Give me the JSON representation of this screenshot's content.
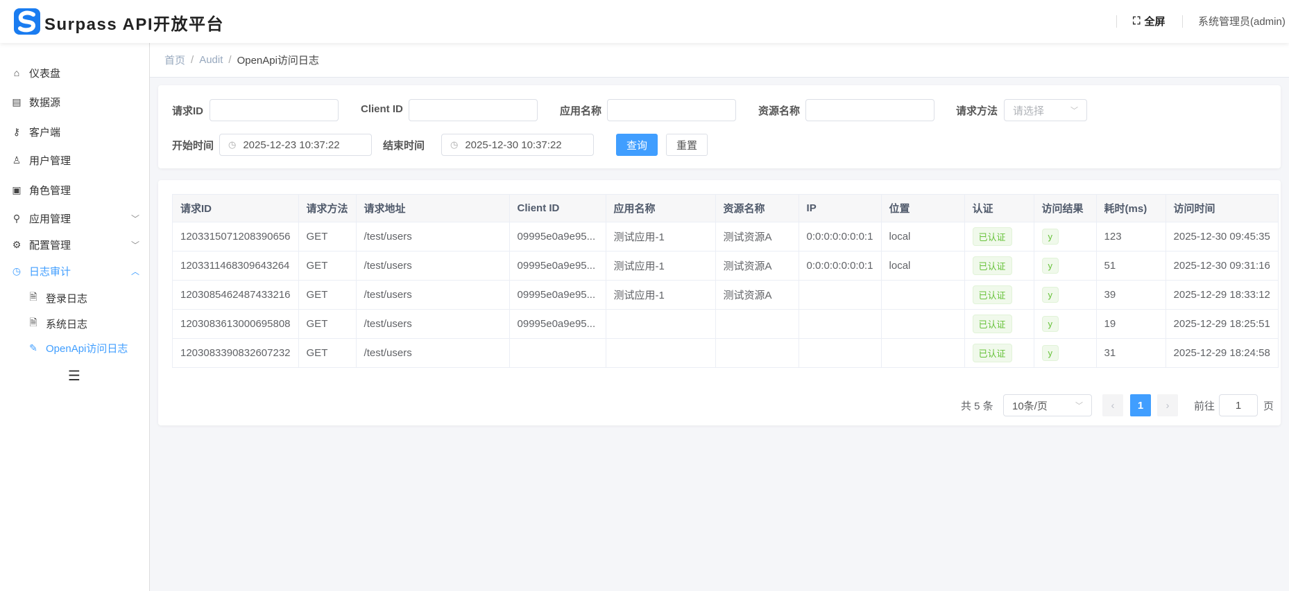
{
  "header": {
    "title": "Surpass API开放平台",
    "logo_letter": "S",
    "fullscreen_label": "全屏",
    "user": "系统管理员(admin)"
  },
  "sidebar": {
    "items": [
      {
        "label": "仪表盘",
        "icon": "home-icon"
      },
      {
        "label": "数据源",
        "icon": "database-icon"
      },
      {
        "label": "客户端",
        "icon": "key-icon"
      },
      {
        "label": "用户管理",
        "icon": "user-icon"
      },
      {
        "label": "角色管理",
        "icon": "role-icon"
      },
      {
        "label": "应用管理",
        "icon": "app-icon",
        "expandable": true
      },
      {
        "label": "配置管理",
        "icon": "config-icon",
        "expandable": true
      },
      {
        "label": "日志审计",
        "icon": "clock-icon",
        "expanded": true,
        "active": true
      }
    ],
    "sub_items": [
      {
        "label": "登录日志"
      },
      {
        "label": "系统日志"
      },
      {
        "label": "OpenApi访问日志",
        "active": true
      }
    ]
  },
  "breadcrumb": [
    "首页",
    "Audit",
    "OpenApi访问日志"
  ],
  "search": {
    "request_id_label": "请求ID",
    "request_id_value": "",
    "client_id_label": "Client ID",
    "client_id_value": "",
    "app_name_label": "应用名称",
    "app_name_value": "",
    "resource_name_label": "资源名称",
    "resource_name_value": "",
    "method_label": "请求方法",
    "method_placeholder": "请选择",
    "start_label": "开始时间",
    "start_value": "2025-12-23 10:37:22",
    "end_label": "结束时间",
    "end_value": "2025-12-30 10:37:22",
    "query_button": "查询",
    "reset_button": "重置"
  },
  "table": {
    "columns": [
      "请求ID",
      "请求方法",
      "请求地址",
      "Client ID",
      "应用名称",
      "资源名称",
      "IP",
      "位置",
      "认证",
      "访问结果",
      "耗时(ms)",
      "访问时间"
    ],
    "rows": [
      [
        "1203315071208390656",
        "GET",
        "/test/users",
        "09995e0a9e95...",
        "测试应用-1",
        "测试资源A",
        "0:0:0:0:0:0:0:1",
        "local",
        "已认证",
        "y",
        "123",
        "2025-12-30 09:45:35"
      ],
      [
        "1203311468309643264",
        "GET",
        "/test/users",
        "09995e0a9e95...",
        "测试应用-1",
        "测试资源A",
        "0:0:0:0:0:0:0:1",
        "local",
        "已认证",
        "y",
        "51",
        "2025-12-30 09:31:16"
      ],
      [
        "1203085462487433216",
        "GET",
        "/test/users",
        "09995e0a9e95...",
        "测试应用-1",
        "测试资源A",
        "",
        "",
        "已认证",
        "y",
        "39",
        "2025-12-29 18:33:12"
      ],
      [
        "1203083613000695808",
        "GET",
        "/test/users",
        "09995e0a9e95...",
        "",
        "",
        "",
        "",
        "已认证",
        "y",
        "19",
        "2025-12-29 18:25:51"
      ],
      [
        "1203083390832607232",
        "GET",
        "/test/users",
        "",
        "",
        "",
        "",
        "",
        "已认证",
        "y",
        "31",
        "2025-12-29 18:24:58"
      ]
    ]
  },
  "pagination": {
    "total": "共 5 条",
    "page_size": "10条/页",
    "current_page": "1",
    "goto_label": "前往",
    "goto_value": "1",
    "page_suffix": "页"
  },
  "colors": {
    "primary": "#409eff",
    "success": "#67c23a"
  }
}
